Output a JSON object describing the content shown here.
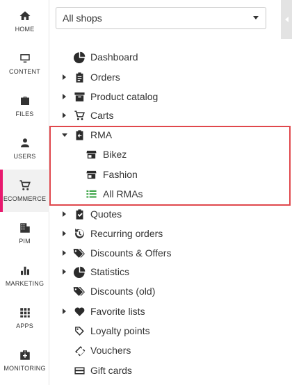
{
  "rail": {
    "items": [
      {
        "label": "HOME",
        "icon": "home-icon"
      },
      {
        "label": "CONTENT",
        "icon": "monitor-icon"
      },
      {
        "label": "FILES",
        "icon": "briefcase-icon"
      },
      {
        "label": "USERS",
        "icon": "user-icon"
      },
      {
        "label": "ECOMMERCE",
        "icon": "cart-icon",
        "active": true
      },
      {
        "label": "PIM",
        "icon": "building-icon"
      },
      {
        "label": "MARKETING",
        "icon": "bar-chart-icon"
      },
      {
        "label": "APPS",
        "icon": "grid-icon"
      },
      {
        "label": "MONITORING",
        "icon": "medkit-icon"
      }
    ]
  },
  "shop_select": {
    "value": "All shops"
  },
  "tree": {
    "dashboard": "Dashboard",
    "orders": "Orders",
    "product_catalog": "Product catalog",
    "carts": "Carts",
    "rma": "RMA",
    "bikez": "Bikez",
    "fashion": "Fashion",
    "all_rmas": "All RMAs",
    "quotes": "Quotes",
    "recurring_orders": "Recurring orders",
    "discounts_offers": "Discounts & Offers",
    "statistics": "Statistics",
    "discounts_old": "Discounts (old)",
    "favorite_lists": "Favorite lists",
    "loyalty_points": "Loyalty points",
    "vouchers": "Vouchers",
    "gift_cards": "Gift cards"
  },
  "colors": {
    "accent": "#e8196e",
    "highlight_box": "#e0474c",
    "all_rmas_icon": "#3aa345"
  }
}
